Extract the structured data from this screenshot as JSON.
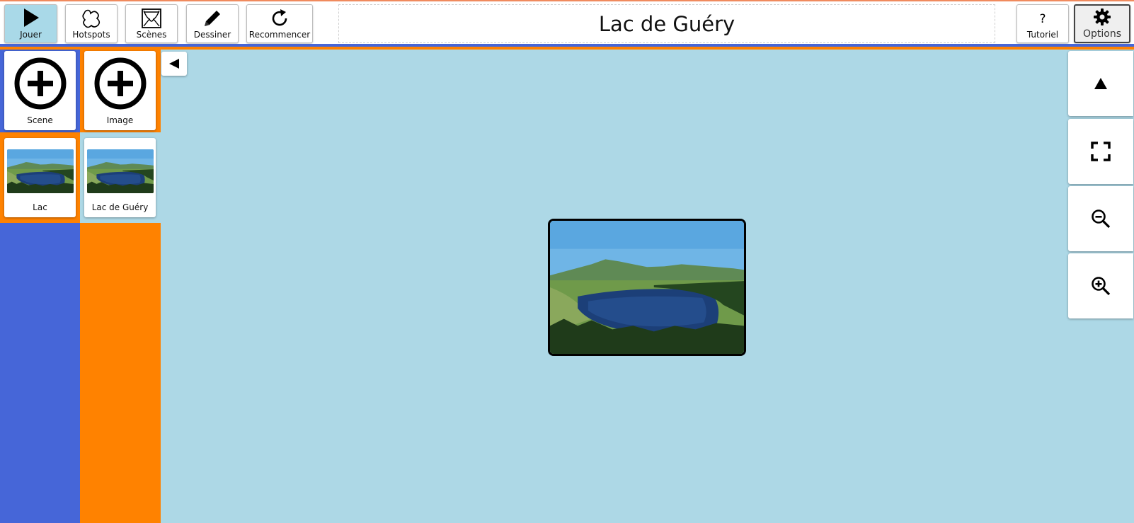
{
  "toolbar": {
    "buttons": [
      {
        "id": "play",
        "label": "Jouer",
        "icon": "play-icon",
        "active": true
      },
      {
        "id": "hotspots",
        "label": "Hotspots",
        "icon": "hotspot-shape-icon"
      },
      {
        "id": "scenes",
        "label": "Scènes",
        "icon": "theater-curtain-icon"
      },
      {
        "id": "draw",
        "label": "Dessiner",
        "icon": "pencil-icon"
      },
      {
        "id": "restart",
        "label": "Recommencer",
        "icon": "refresh-icon"
      }
    ],
    "title": "Lac de Guéry",
    "help": {
      "label": "Tutoriel",
      "icon_text": "?"
    },
    "options": {
      "label": "Options",
      "icon": "gear-icon"
    }
  },
  "sidebar": {
    "scenes_column": {
      "add_card_label": "Scene",
      "items": [
        {
          "label": "Lac"
        }
      ]
    },
    "images_column": {
      "add_card_label": "Image",
      "items": [
        {
          "label": "Lac de Guéry"
        }
      ]
    }
  },
  "canvas": {
    "collapse_icon": "triangle-left-icon",
    "image_name": "lake-landscape-image"
  },
  "right_controls": [
    {
      "id": "up",
      "icon": "triangle-up-icon"
    },
    {
      "id": "fullscreen",
      "icon": "fullscreen-icon"
    },
    {
      "id": "zoom_out",
      "icon": "zoom-out-icon"
    },
    {
      "id": "zoom_in",
      "icon": "zoom-in-icon"
    }
  ],
  "colors": {
    "canvas_bg": "#add8e6",
    "scenes_panel": "#4666d8",
    "images_panel": "#ff8200",
    "active_button": "#a9d9e8"
  }
}
